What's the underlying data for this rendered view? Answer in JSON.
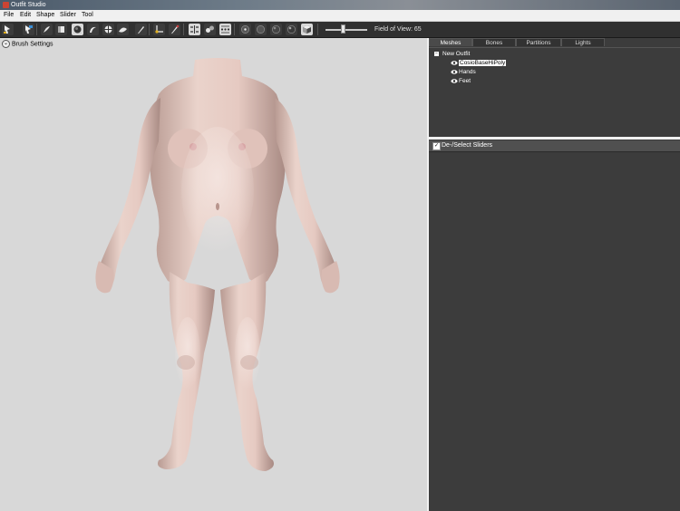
{
  "window": {
    "title": "Outfit Studio"
  },
  "menu": [
    {
      "label": "File"
    },
    {
      "label": "Edit"
    },
    {
      "label": "Shape"
    },
    {
      "label": "Slider"
    },
    {
      "label": "Tool"
    }
  ],
  "toolbar": {
    "buttons": [
      {
        "name": "select-tool",
        "icon": "select-arrow-icon",
        "active": false
      },
      {
        "name": "transform-tool",
        "icon": "transform-icon",
        "active": false
      },
      {
        "name": "mask-brush",
        "icon": "mask-brush-icon",
        "active": false
      },
      {
        "name": "inflate-brush",
        "icon": "inflate-brush-icon",
        "active": false
      },
      {
        "name": "deflate-brush",
        "icon": "deflate-brush-icon",
        "active": true
      },
      {
        "name": "move-brush",
        "icon": "move-brush-icon",
        "active": false
      },
      {
        "name": "smooth-brush",
        "icon": "smooth-brush-icon",
        "active": false
      },
      {
        "name": "undiff-brush",
        "icon": "undiff-brush-icon",
        "active": false
      },
      {
        "name": "weight-brush",
        "icon": "weight-brush-icon",
        "active": false
      },
      {
        "name": "color-brush",
        "icon": "color-brush-icon",
        "active": false
      },
      {
        "name": "pivot-tool",
        "icon": "pivot-icon",
        "active": false
      },
      {
        "name": "vertex-edit",
        "icon": "vertex-edit-icon",
        "active": false
      },
      {
        "name": "x-mirror",
        "icon": "x-mirror-icon",
        "active": true
      },
      {
        "name": "connected-only",
        "icon": "connected-icon",
        "active": false
      },
      {
        "name": "global-brush",
        "icon": "global-brush-icon",
        "active": true
      },
      {
        "name": "vertex-points",
        "icon": "vertex-points-icon",
        "active": false
      },
      {
        "name": "wireframe",
        "icon": "wireframe-icon",
        "active": false
      },
      {
        "name": "lighting",
        "icon": "lighting-icon",
        "active": false
      },
      {
        "name": "textures",
        "icon": "textures-icon",
        "active": false
      },
      {
        "name": "shaded-cube",
        "icon": "cube-icon",
        "active": true
      }
    ],
    "field_of_view_label": "Field of View: 65",
    "field_of_view_value": 65
  },
  "viewport": {
    "brush_settings_label": "Brush Settings"
  },
  "right_panel": {
    "tabs": [
      {
        "label": "Meshes",
        "active": true
      },
      {
        "label": "Bones",
        "active": false
      },
      {
        "label": "Partitions",
        "active": false
      },
      {
        "label": "Lights",
        "active": false
      }
    ],
    "tree": {
      "root": "New Outfit",
      "meshes": [
        {
          "label": "CosioBaseHiPoly",
          "selected": true
        },
        {
          "label": "Hands",
          "selected": false
        },
        {
          "label": "Feet",
          "selected": false
        }
      ]
    },
    "sliders_header": {
      "label": "De-/Select Sliders",
      "checked": true
    }
  },
  "colors": {
    "viewport_bg": "#d8d8d8",
    "panel_bg": "#3c3c3c",
    "toolbar_bg": "#303030",
    "skin": "#e3c5bd"
  }
}
